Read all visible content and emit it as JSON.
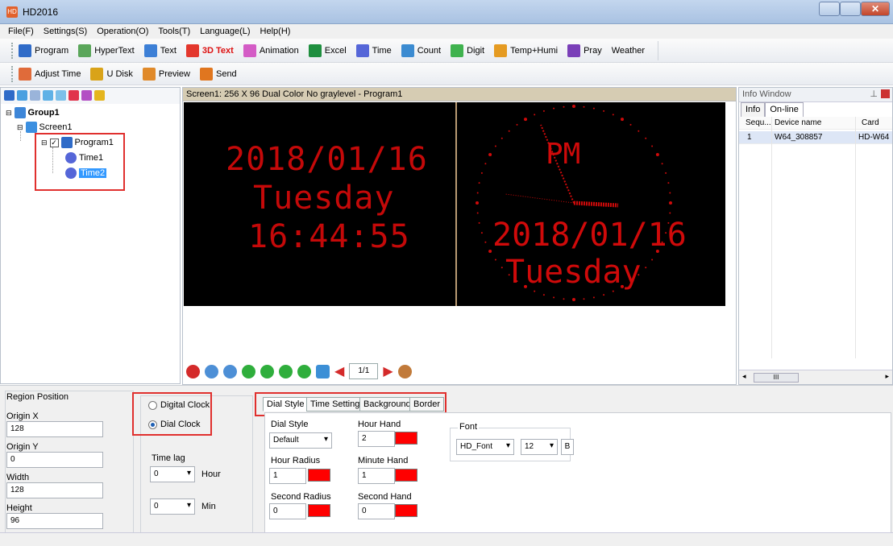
{
  "app": {
    "title": "HD2016",
    "icon_text": "HD"
  },
  "menu": [
    "File(F)",
    "Settings(S)",
    "Operation(O)",
    "Tools(T)",
    "Language(L)",
    "Help(H)"
  ],
  "toolbar1": [
    {
      "label": "Program",
      "icon": "program-icon",
      "color": "#2f6bc8"
    },
    {
      "label": "HyperText",
      "icon": "hypertext-icon",
      "color": "#5aa65a"
    },
    {
      "label": "Text",
      "icon": "text-icon",
      "color": "#3c7fd6"
    },
    {
      "label": "3D Text",
      "icon": "3d-text-icon",
      "color": "#e3372d"
    },
    {
      "label": "Animation",
      "icon": "animation-icon",
      "color": "#d45cc6"
    },
    {
      "label": "Excel",
      "icon": "excel-icon",
      "color": "#1f8f3f"
    },
    {
      "label": "Time",
      "icon": "time-icon",
      "color": "#5566d8"
    },
    {
      "label": "Count",
      "icon": "count-icon",
      "color": "#3b8bd1"
    },
    {
      "label": "Digit",
      "icon": "digit-icon",
      "color": "#3fb24e"
    },
    {
      "label": "Temp+Humi",
      "icon": "temp-humi-icon",
      "color": "#e59b22"
    },
    {
      "label": "Pray",
      "icon": "pray-icon",
      "color": "#7a3fb8"
    },
    {
      "label": "Weather",
      "icon": "",
      "color": ""
    }
  ],
  "toolbar2": [
    {
      "label": "Adjust Time",
      "icon": "adjust-time-icon",
      "color": "#e06b3a"
    },
    {
      "label": "U Disk",
      "icon": "u-disk-icon",
      "color": "#d9a319"
    },
    {
      "label": "Preview",
      "icon": "preview-icon",
      "color": "#e08a2a"
    },
    {
      "label": "Send",
      "icon": "send-icon",
      "color": "#e0761f"
    }
  ],
  "tree": {
    "group": "Group1",
    "screen": "Screen1",
    "program": "Program1",
    "items": [
      "Time1",
      "Time2"
    ],
    "selected": "Time2"
  },
  "preview": {
    "header": "Screen1: 256 X 96  Dual Color No graylevel - Program1",
    "digital": {
      "date": "2018/01/16",
      "day": "Tuesday",
      "time": "16:44:55"
    },
    "dial": {
      "ampm": "PM",
      "date": "2018/01/16",
      "day": "Tuesday"
    },
    "page": "1/1"
  },
  "info": {
    "title": "Info Window",
    "tabs": [
      "Info",
      "On-line"
    ],
    "columns": [
      "Sequ...",
      "Device name",
      "Card"
    ],
    "rows": [
      {
        "seq": "1",
        "device": "W64_308857",
        "card": "HD-W64"
      }
    ],
    "scroll_label": "III"
  },
  "region": {
    "title": "Region Position",
    "origin_x_label": "Origin X",
    "origin_x": "128",
    "origin_y_label": "Origin Y",
    "origin_y": "0",
    "width_label": "Width",
    "width": "128",
    "height_label": "Height",
    "height": "96"
  },
  "clock_type": {
    "digital_label": "Digital Clock",
    "dial_label": "Dial Clock",
    "selected": "Dial Clock",
    "time_lag_label": "Time lag",
    "hour_value": "0",
    "hour_label": "Hour",
    "min_value": "0",
    "min_label": "Min"
  },
  "tabs": [
    "Dial Style",
    "Time Settings",
    "Background",
    "Border"
  ],
  "dial_style": {
    "dial_style_label": "Dial Style",
    "dial_style_value": "Default",
    "hour_radius_label": "Hour Radius",
    "hour_radius": "1",
    "second_radius_label": "Second Radius",
    "second_radius": "0",
    "hour_hand_label": "Hour Hand",
    "hour_hand": "2",
    "minute_hand_label": "Minute Hand",
    "minute_hand": "1",
    "second_hand_label": "Second Hand",
    "second_hand": "0",
    "font_label": "Font",
    "font_value": "HD_Font",
    "size_value": "12",
    "bold_label": "B"
  }
}
